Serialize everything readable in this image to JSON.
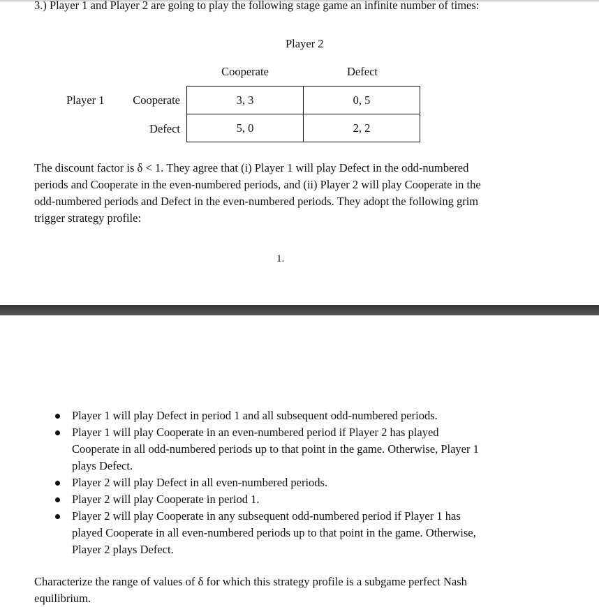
{
  "question": {
    "text": "3.)  Player 1 and Player 2 are going to play the following stage game an infinite number of times:"
  },
  "game": {
    "column_player": "Player 2",
    "row_player": "Player 1",
    "column_actions": [
      "Cooperate",
      "Defect"
    ],
    "row_actions": [
      "Cooperate",
      "Defect"
    ],
    "payoffs": [
      [
        "3, 3",
        "0, 5"
      ],
      [
        "5, 0",
        "2, 2"
      ]
    ]
  },
  "paragraph": {
    "lines": [
      "The discount factor is δ < 1. They agree that (i) Player 1 will play Defect in the odd-numbered",
      "periods and Cooperate in the even-numbered periods, and (ii) Player 2 will play Cooperate in the",
      "odd-numbered periods and Defect in the even-numbered periods. They adopt the following grim",
      "trigger strategy profile:"
    ]
  },
  "page_number": "1.",
  "bullets": [
    {
      "lines": [
        "Player 1 will play Defect in period 1 and all subsequent odd-numbered periods."
      ]
    },
    {
      "lines": [
        "Player 1 will play Cooperate in an even-numbered period if Player 2 has played",
        "Cooperate in all odd-numbered periods up to that point in the game. Otherwise, Player 1",
        "plays Defect."
      ]
    },
    {
      "lines": [
        "Player 2 will play Defect in all even-numbered periods."
      ]
    },
    {
      "lines": [
        "Player 2 will play Cooperate in period 1."
      ]
    },
    {
      "lines": [
        "Player 2 will play Cooperate in any subsequent odd-numbered period if Player 1 has",
        "played Cooperate in all even-numbered periods up to that point in the game. Otherwise,",
        "Player 2 plays Defect."
      ]
    }
  ],
  "closing": {
    "lines": [
      "Characterize the range of values of δ for which this strategy profile is a subgame perfect Nash",
      "equilibrium."
    ]
  }
}
